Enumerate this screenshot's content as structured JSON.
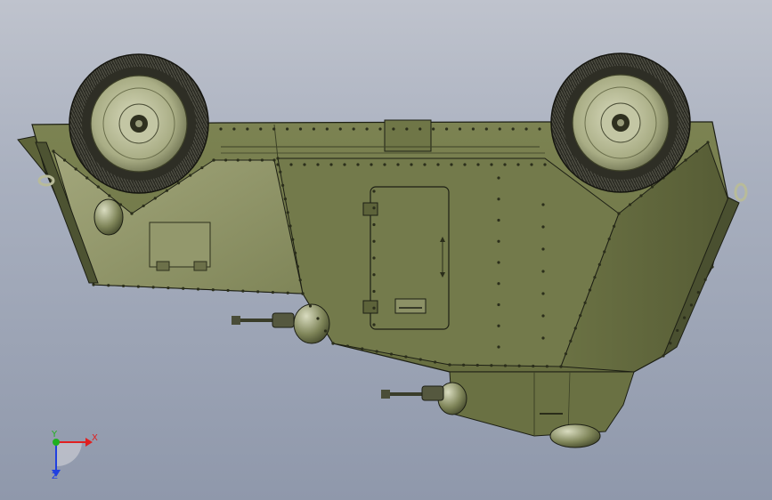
{
  "window": {
    "title": ""
  },
  "scene": {
    "object": "armored-car-underside",
    "colors": {
      "background_top": "#bfc3cd",
      "background_bottom": "#8f98ab",
      "hull_light": "#8b9066",
      "hull_mid": "#6e7547",
      "hull_dark": "#4a5030",
      "tire": "#2a2a22",
      "rim": "#b9bd97",
      "edge": "#1d1f14"
    }
  },
  "triad": {
    "x_label": "X",
    "y_label": "Y",
    "z_label": "Z",
    "colors": {
      "x": "#e02020",
      "y": "#20b020",
      "z": "#2040e0"
    }
  }
}
